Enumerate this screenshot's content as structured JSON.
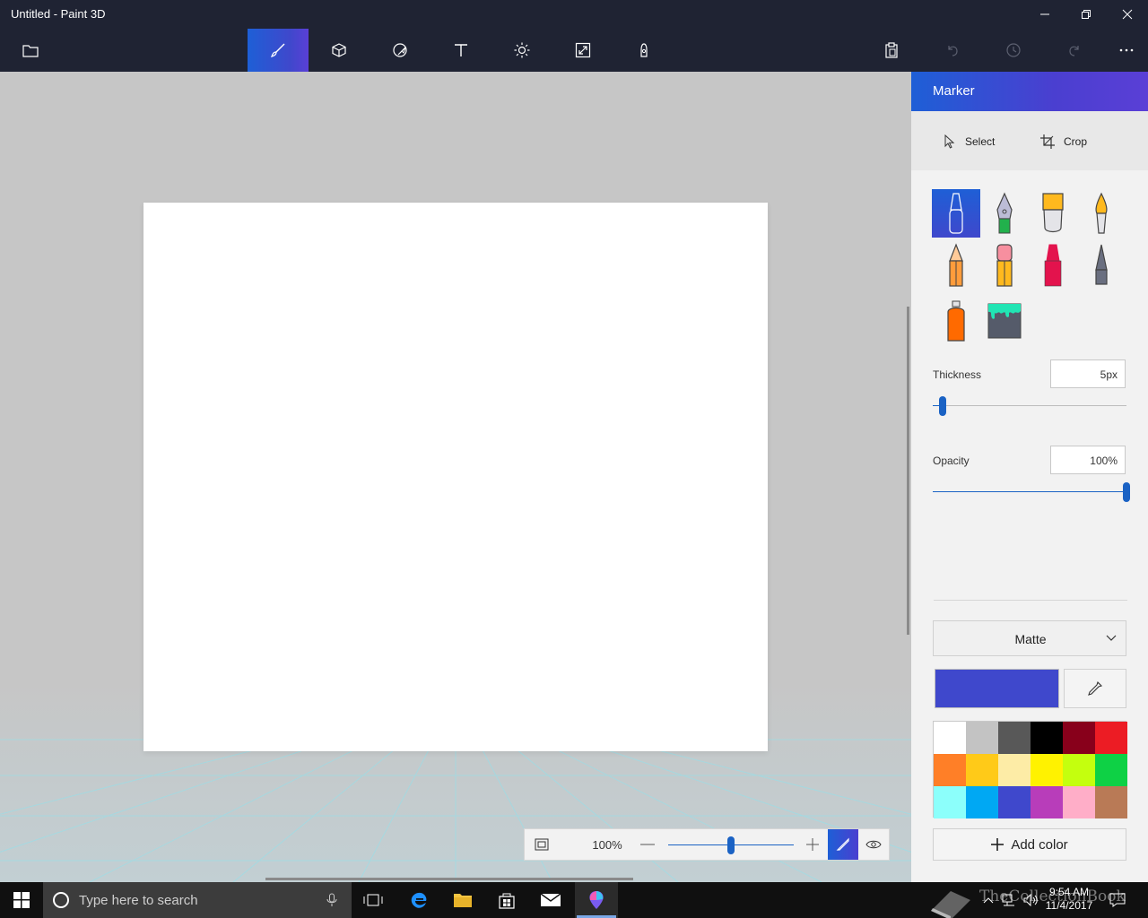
{
  "window": {
    "title": "Untitled - Paint 3D",
    "minimize_icon": "minimize-icon",
    "restore_icon": "restore-icon",
    "close_icon": "close-icon"
  },
  "toolbar": {
    "menu_icon": "folder-icon",
    "tools": [
      {
        "name": "brushes",
        "icon": "brush-icon",
        "active": true
      },
      {
        "name": "3d-shapes",
        "icon": "cube-icon"
      },
      {
        "name": "stickers",
        "icon": "sticker-icon"
      },
      {
        "name": "text",
        "icon": "text-icon"
      },
      {
        "name": "effects",
        "icon": "sun-icon"
      },
      {
        "name": "canvas",
        "icon": "resize-icon"
      },
      {
        "name": "remix-3d",
        "icon": "remix-icon"
      }
    ],
    "right_actions": [
      "paste-icon",
      "undo-icon",
      "history-icon",
      "redo-icon",
      "more-icon"
    ]
  },
  "panel": {
    "title": "Marker",
    "select_label": "Select",
    "crop_label": "Crop",
    "brushes": [
      {
        "name": "marker",
        "active": true
      },
      {
        "name": "calligraphy-pen"
      },
      {
        "name": "oil-brush"
      },
      {
        "name": "watercolor"
      },
      {
        "name": "pencil"
      },
      {
        "name": "eraser"
      },
      {
        "name": "crayon"
      },
      {
        "name": "pixel-pen"
      },
      {
        "name": "spray-can"
      },
      {
        "name": "fill"
      }
    ],
    "thickness_label": "Thickness",
    "thickness_value": "5px",
    "thickness_level": 0.05,
    "opacity_label": "Opacity",
    "opacity_value": "100%",
    "opacity_level": 1.0,
    "finish": "Matte",
    "current_color": "#3f48cc",
    "palette": [
      "#ffffff",
      "#c3c3c3",
      "#585858",
      "#000000",
      "#88001b",
      "#ec1c24",
      "#ff7f27",
      "#ffca18",
      "#fdeca6",
      "#fff200",
      "#c4ff0e",
      "#0ed145",
      "#8cfffb",
      "#00a8f3",
      "#3f48cc",
      "#b83dba",
      "#ffaec8",
      "#b97a56"
    ],
    "add_color_label": "Add color"
  },
  "zoom": {
    "value": "100%",
    "level": 0.5
  },
  "taskbar": {
    "search_placeholder": "Type here to search",
    "time": "9:54 AM",
    "date": "11/4/2017",
    "watermark": "TheCollectionBook"
  }
}
